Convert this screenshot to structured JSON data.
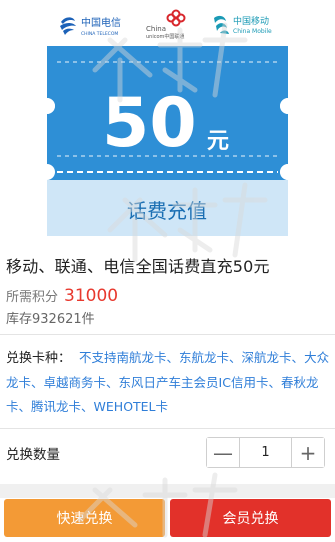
{
  "banner": {
    "telecom_logo_text": "中国电信",
    "telecom_logo_sub": "CHINA TELECOM",
    "unicom_logo_text": "China unicom中国联通",
    "unicom_brand": "China",
    "unicom_brand_line2": "unicom中国联通",
    "mobile_logo_text": "中国移动",
    "mobile_logo_sub": "China Mobile",
    "amount": "50",
    "unit": "元",
    "subtitle": "话费充值",
    "colors": {
      "blue": "#2e8fd6",
      "light_blue": "#cfe6f7",
      "mobile_teal": "#1a9ab5",
      "unicom_red": "#d8262b"
    }
  },
  "product": {
    "title": "移动、联通、电信全国话费直充50元",
    "points_label": "所需积分",
    "points_value": "31000",
    "stock_text": "库存932621件"
  },
  "cards": {
    "label": "兑换卡种：",
    "items": [
      "不支持南航龙卡、",
      "东航龙卡、",
      "深航龙卡、",
      "大众龙卡、",
      "卓越商务卡、",
      "东风日产车主会员IC信用卡、",
      "春秋龙卡、",
      "腾讯龙卡、",
      "WEHOTEL卡"
    ]
  },
  "quantity": {
    "label": "兑换数量",
    "value": "1",
    "minus": "—",
    "plus": "+"
  },
  "actions": {
    "quick_label": "快速兑换",
    "member_label": "会员兑换",
    "quick_color": "#f39a36",
    "member_color": "#e2312a"
  }
}
